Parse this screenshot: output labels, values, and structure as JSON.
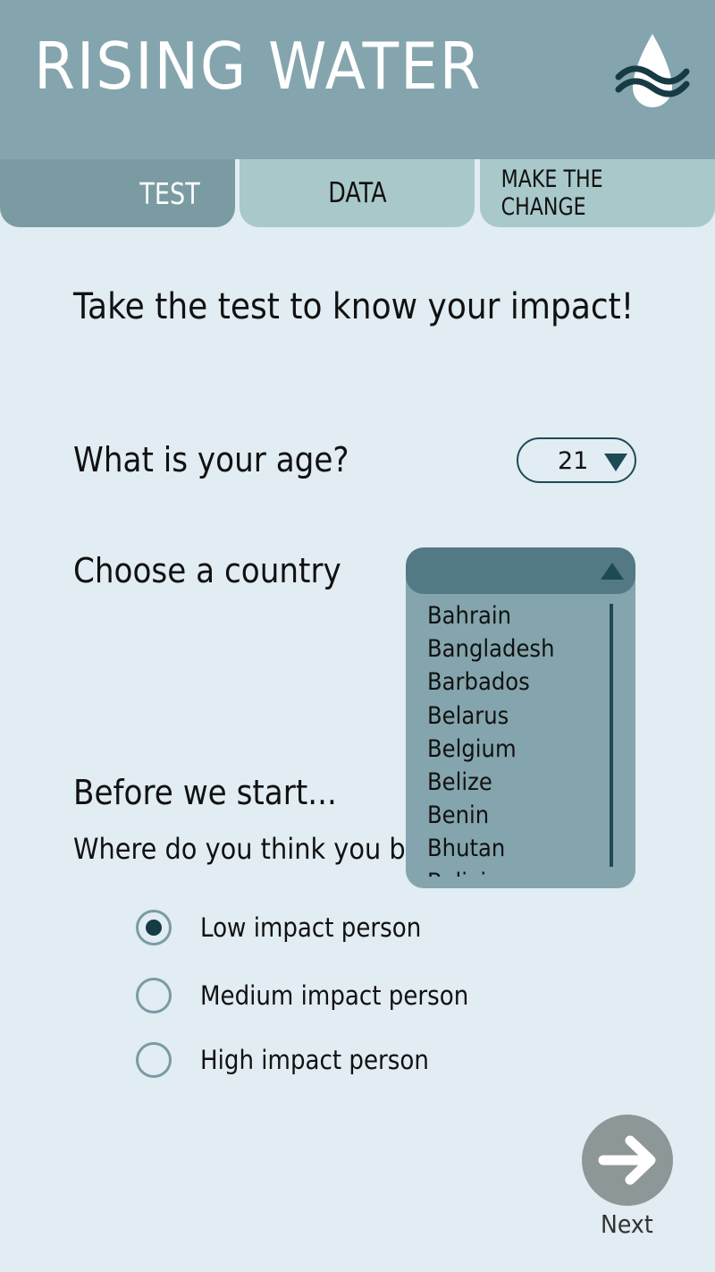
{
  "header": {
    "title": "RISING WATER",
    "logo_icon": "water-drop-waves-icon"
  },
  "tabs": [
    {
      "label": "TEST",
      "active": true
    },
    {
      "label": "DATA",
      "active": false
    },
    {
      "label": "MAKE THE CHANGE",
      "active": false
    }
  ],
  "main": {
    "headline": "Take the test to know your impact!",
    "age_question": "What is your age?",
    "age_value": "21",
    "country_question": "Choose a country",
    "before_heading": "Before we start...",
    "where_question": "Where do you think you b",
    "country_options": [
      "Bahrain",
      "Bangladesh",
      "Barbados",
      "Belarus",
      "Belgium",
      "Belize",
      "Benin",
      "Bhutan",
      "Bolivia"
    ],
    "impact_options": [
      {
        "label": "Low impact person",
        "selected": true
      },
      {
        "label": "Medium impact person",
        "selected": false
      },
      {
        "label": "High impact person",
        "selected": false
      }
    ],
    "next_label": "Next"
  },
  "colors": {
    "header": "#84a5ad",
    "tab_active": "#7a9ba2",
    "tab_inactive": "#a9c8c9",
    "background": "#e1ecf3",
    "accent_dark": "#1e4a55",
    "dropdown_bg": "#84a5ad",
    "dropdown_header": "#537a84",
    "next_button": "#8e9797"
  }
}
